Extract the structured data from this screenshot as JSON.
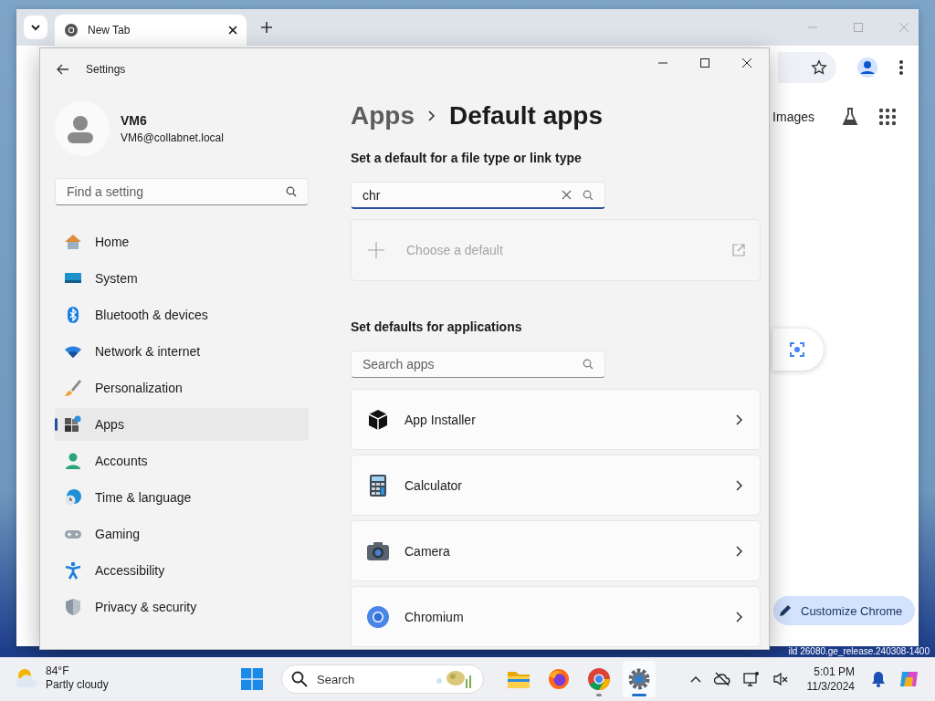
{
  "desktop": {
    "build_text": "ild 26080.ge_release.240308-1400"
  },
  "browser": {
    "tabs": [
      {
        "title": "New Tab",
        "selected": true
      }
    ],
    "header_links": [
      "Images"
    ],
    "customize_button": "Customize Chrome"
  },
  "settings": {
    "title": "Settings",
    "user": {
      "name": "VM6",
      "email": "VM6@collabnet.local"
    },
    "search": {
      "placeholder": "Find a setting"
    },
    "nav": [
      {
        "label": "Home",
        "selected": false
      },
      {
        "label": "System",
        "selected": false
      },
      {
        "label": "Bluetooth & devices",
        "selected": false
      },
      {
        "label": "Network & internet",
        "selected": false
      },
      {
        "label": "Personalization",
        "selected": false
      },
      {
        "label": "Apps",
        "selected": true
      },
      {
        "label": "Accounts",
        "selected": false
      },
      {
        "label": "Time & language",
        "selected": false
      },
      {
        "label": "Gaming",
        "selected": false
      },
      {
        "label": "Accessibility",
        "selected": false
      },
      {
        "label": "Privacy & security",
        "selected": false
      }
    ],
    "breadcrumb": {
      "parent": "Apps",
      "current": "Default apps"
    },
    "file_type_section": {
      "heading": "Set a default for a file type or link type",
      "search": {
        "value": "chr",
        "focused": true
      },
      "choose": {
        "label": "Choose a default",
        "disabled": true
      }
    },
    "apps_section": {
      "heading": "Set defaults for applications",
      "search": {
        "placeholder": "Search apps"
      },
      "apps": [
        {
          "name": "App Installer"
        },
        {
          "name": "Calculator"
        },
        {
          "name": "Camera"
        },
        {
          "name": "Chromium"
        }
      ]
    }
  },
  "taskbar": {
    "weather": {
      "temperature": "84°F",
      "condition": "Partly cloudy"
    },
    "search": {
      "placeholder": "Search"
    },
    "apps": [
      {
        "running": false,
        "selected": false
      },
      {
        "running": false,
        "selected": false
      },
      {
        "running": true,
        "selected": false
      },
      {
        "running": true,
        "selected": true
      }
    ],
    "time": "5:01 PM",
    "date": "11/3/2024"
  }
}
